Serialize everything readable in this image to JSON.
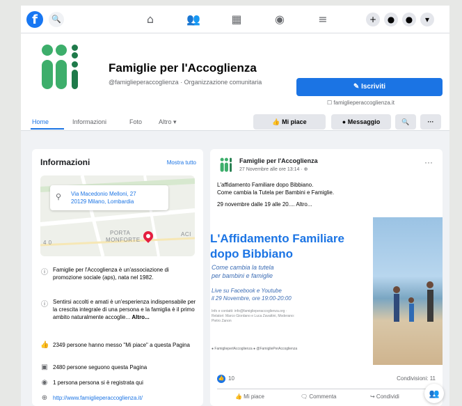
{
  "colors": {
    "brand": "#1877f2",
    "accent": "#1b74e4",
    "logo_green": "#3dae6b",
    "logo_dark": "#1f7a4a"
  },
  "topbar": {
    "logo": "f",
    "search_icon": "🔍",
    "nav_icons": [
      "home-icon",
      "friends-icon",
      "marketplace-icon",
      "groups-icon",
      "menu-icon"
    ],
    "nav_glyphs": [
      "⌂",
      "👥",
      "▦",
      "◉",
      "≡"
    ],
    "actions": [
      "+",
      "●",
      "●",
      "▾"
    ]
  },
  "header": {
    "title": "Famiglie per l'Accoglienza",
    "subtitle": "@famiglieperaccoglienza · Organizzazione comunitaria",
    "subscribe_label": "✎ Iscriviti",
    "ext_link": "☐ famiglieperaccoglienza.it",
    "tabs": [
      "Home",
      "Informazioni",
      "Foto",
      "Altro ▾"
    ],
    "like_label": "👍 Mi piace",
    "message_label": "● Messaggio",
    "search_icon": "🔍",
    "more_label": "···"
  },
  "info": {
    "title": "Informazioni",
    "see_all": "Mostra tutto",
    "address_line1": "Via Macedonio Melloni, 27",
    "address_line2": "20129 Milano, Lombardia",
    "map_label_1": "PORTA",
    "map_label_2": "MONFORTE",
    "map_label_3": "ACI",
    "map_label_4": "4 0",
    "rows": [
      {
        "icon": "ⓘ",
        "text": "Famiglie per l'Accoglienza è un'associazione di promozione sociale (aps), nata nel 1982."
      },
      {
        "icon": "ⓘ",
        "text": "Sentirsi accolti e amati è un'esperienza indispensabile per la crescita integrale di una persona e la famiglia è il primo ambito naturalmente accoglie...",
        "more": "Altro..."
      },
      {
        "icon": "👍",
        "text": "2349 persone hanno messo \"Mi piace\" a questa Pagina"
      },
      {
        "icon": "▣",
        "text": "2480 persone seguono questa Pagina"
      },
      {
        "icon": "◉",
        "text": "1 persona persona si è registrata qui"
      },
      {
        "icon": "⊕",
        "text": "http://www.famiglieperaccoglienza.it/"
      }
    ]
  },
  "post": {
    "author": "Famiglie per l'Accoglienza",
    "time": "27 Novembre alle ore 13:14 · ⊕",
    "more_icon": "···",
    "line1": "L'affidamento Familiare dopo Bibbiano.",
    "line2": "Come cambia la Tutela per Bambini e Famiglie.",
    "line3": "29 novembre dalle 19 alle 20.... Altro...",
    "image": {
      "title": "L'Affidamento Familiare dopo Bibbiano",
      "subtitle1": "Come cambia la tutela",
      "subtitle2": "per bambini e famiglie",
      "live1": "Live su Facebook e Youtube",
      "live2": "il 29 Novembre, ore 19:00-20:00",
      "small": "Info e contatti: info@famiglieperaccoglienza.org · Relatori: Marco Giordano e Luca Zavattini, Moderano: Pietro Zanon",
      "social": "● FamiglieperlAccoglienza   ● @FamigliePerAccoglienza"
    },
    "reactions": "10",
    "shares": "Condivisioni: 11",
    "like": "👍 Mi piace",
    "comment": "🗨 Commenta",
    "share": "↪ Condividi",
    "chat_icon": "👥"
  }
}
